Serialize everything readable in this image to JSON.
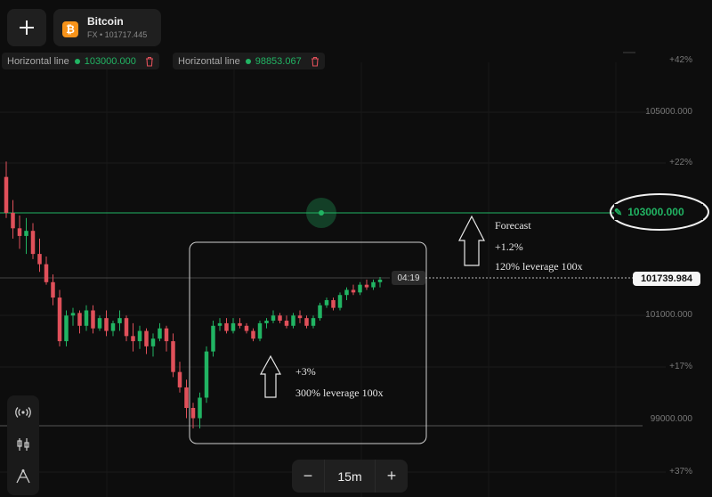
{
  "header": {
    "add_button_icon": "plus-icon",
    "asset": {
      "name": "Bitcoin",
      "subtitle": "FX • 101717.445",
      "icon": "bitcoin-icon",
      "icon_color": "#f7931a"
    }
  },
  "horizontal_lines": [
    {
      "label": "Horizontal line",
      "value": "103000.000"
    },
    {
      "label": "Horizontal line",
      "value": "98853.067"
    }
  ],
  "axis": {
    "labels": [
      "+42%",
      "105000.000",
      "+22%",
      "101000.000",
      "+17%",
      "99000.000",
      "+37%"
    ]
  },
  "price_line_tag": "103000.000",
  "current_price": "101739.984",
  "candle_timer": "04:19",
  "timeframe": {
    "value": "15m",
    "minus": "−",
    "plus": "+"
  },
  "annotations": {
    "forecast_title": "Forecast",
    "forecast_pct": "+1.2%",
    "forecast_leverage": "120% leverage 100x",
    "box_pct": "+3%",
    "box_leverage": "300% leverage 100x"
  },
  "toolbar": {
    "icons": [
      "broadcast-icon",
      "candles-icon",
      "draw-tool-icon"
    ]
  },
  "colors": {
    "up": "#21b463",
    "down": "#e0505a",
    "line": "#21b463",
    "background": "#0d0d0d"
  },
  "chart_data": {
    "type": "candlestick",
    "series": [
      {
        "name": "",
        "ohlc": [
          [
            103700,
            104000,
            102900,
            103000
          ],
          [
            103000,
            103250,
            102500,
            102700
          ],
          [
            102700,
            102950,
            102300,
            102550
          ],
          [
            102550,
            102900,
            102200,
            102650
          ],
          [
            102650,
            102800,
            102100,
            102200
          ],
          [
            102200,
            102500,
            101850,
            102000
          ],
          [
            102000,
            102150,
            101600,
            101650
          ],
          [
            101650,
            101800,
            101200,
            101350
          ],
          [
            101350,
            101500,
            100400,
            100500
          ],
          [
            100500,
            101100,
            100400,
            101000
          ],
          [
            101000,
            101150,
            100800,
            101050
          ],
          [
            101050,
            101100,
            100650,
            100800
          ],
          [
            100800,
            101200,
            100700,
            101100
          ],
          [
            101100,
            101200,
            100650,
            100750
          ],
          [
            100750,
            101000,
            100700,
            100950
          ],
          [
            100950,
            101100,
            100600,
            100700
          ],
          [
            100700,
            100900,
            100600,
            100850
          ],
          [
            100850,
            101100,
            100700,
            100950
          ],
          [
            100950,
            101000,
            100500,
            100600
          ],
          [
            100600,
            100850,
            100300,
            100500
          ],
          [
            100500,
            100800,
            100350,
            100700
          ],
          [
            100700,
            100750,
            100250,
            100400
          ],
          [
            100400,
            100650,
            100200,
            100550
          ],
          [
            100550,
            100850,
            100500,
            100750
          ],
          [
            100750,
            100800,
            100300,
            100500
          ],
          [
            100500,
            100650,
            99800,
            99900
          ],
          [
            99900,
            100100,
            99500,
            99600
          ],
          [
            99600,
            99750,
            99000,
            99200
          ],
          [
            99200,
            99300,
            98800,
            99000
          ],
          [
            99000,
            99500,
            98800,
            99400
          ],
          [
            99400,
            100400,
            99300,
            100300
          ],
          [
            100300,
            100900,
            100200,
            100800
          ],
          [
            100800,
            100950,
            100700,
            100850
          ],
          [
            100850,
            100950,
            100650,
            100700
          ],
          [
            100700,
            100950,
            100650,
            100850
          ],
          [
            100850,
            100950,
            100750,
            100800
          ],
          [
            100800,
            100850,
            100650,
            100700
          ],
          [
            100700,
            100750,
            100500,
            100550
          ],
          [
            100550,
            100900,
            100500,
            100850
          ],
          [
            100850,
            100950,
            100750,
            100900
          ],
          [
            100900,
            101100,
            100850,
            101000
          ],
          [
            101000,
            101050,
            100850,
            100900
          ],
          [
            100900,
            101000,
            100750,
            100800
          ],
          [
            100800,
            101050,
            100750,
            101000
          ],
          [
            101000,
            101100,
            100850,
            100950
          ],
          [
            100950,
            101000,
            100750,
            100800
          ],
          [
            100800,
            101000,
            100750,
            100950
          ],
          [
            100950,
            101250,
            100900,
            101200
          ],
          [
            101200,
            101350,
            101150,
            101300
          ],
          [
            101300,
            101350,
            101100,
            101150
          ],
          [
            101150,
            101450,
            101100,
            101400
          ],
          [
            101400,
            101550,
            101300,
            101500
          ],
          [
            101500,
            101600,
            101400,
            101450
          ],
          [
            101450,
            101650,
            101400,
            101600
          ],
          [
            101600,
            101700,
            101500,
            101550
          ],
          [
            101550,
            101700,
            101500,
            101650
          ],
          [
            101650,
            101750,
            101550,
            101700
          ]
        ]
      }
    ],
    "y_range": [
      98500,
      105500
    ],
    "reference_lines": [
      103000,
      98853.067
    ],
    "current_price": 101739.984
  }
}
